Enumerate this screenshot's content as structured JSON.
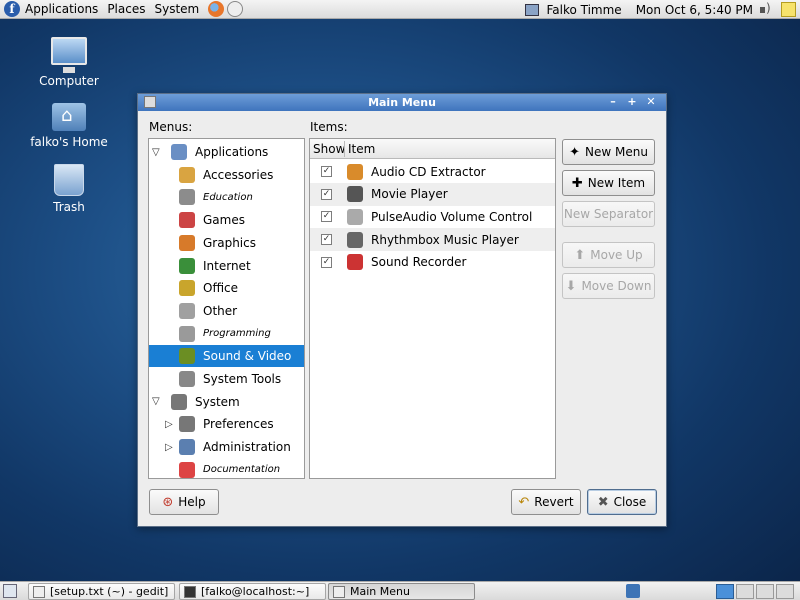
{
  "top_panel": {
    "applications": "Applications",
    "places": "Places",
    "system": "System",
    "user": "Falko Timme",
    "clock": "Mon Oct  6,  5:40 PM"
  },
  "desktop": {
    "icons": [
      {
        "label": "Computer",
        "icon": "computer-icon"
      },
      {
        "label": "falko's Home",
        "icon": "home-folder-icon"
      },
      {
        "label": "Trash",
        "icon": "trash-icon"
      }
    ]
  },
  "window": {
    "title": "Main Menu",
    "menus_label": "Menus:",
    "items_label": "Items:",
    "menus": [
      {
        "label": "Applications",
        "icon": "applications-icon",
        "level": 0,
        "expanded": true
      },
      {
        "label": "Accessories",
        "icon": "accessories-icon",
        "level": 1
      },
      {
        "label": "Education",
        "icon": "education-icon",
        "level": 1,
        "small": true
      },
      {
        "label": "Games",
        "icon": "games-icon",
        "level": 1
      },
      {
        "label": "Graphics",
        "icon": "graphics-icon",
        "level": 1
      },
      {
        "label": "Internet",
        "icon": "internet-icon",
        "level": 1
      },
      {
        "label": "Office",
        "icon": "office-icon",
        "level": 1
      },
      {
        "label": "Other",
        "icon": "other-icon",
        "level": 1
      },
      {
        "label": "Programming",
        "icon": "programming-icon",
        "level": 1,
        "small": true
      },
      {
        "label": "Sound & Video",
        "icon": "sound-video-icon",
        "level": 1,
        "selected": true
      },
      {
        "label": "System Tools",
        "icon": "system-tools-icon",
        "level": 1
      },
      {
        "label": "System",
        "icon": "system-icon",
        "level": 0,
        "expanded": true
      },
      {
        "label": "Preferences",
        "icon": "preferences-icon",
        "level": 1,
        "collapsed": true
      },
      {
        "label": "Administration",
        "icon": "administration-icon",
        "level": 1,
        "collapsed": true
      },
      {
        "label": "Documentation",
        "icon": "documentation-icon",
        "level": 1,
        "small": true
      }
    ],
    "items_header": {
      "show": "Show",
      "item": "Item"
    },
    "items": [
      {
        "label": "Audio CD Extractor",
        "icon": "cd-extractor-icon",
        "shown": true
      },
      {
        "label": "Movie Player",
        "icon": "movie-player-icon",
        "shown": true
      },
      {
        "label": "PulseAudio Volume Control",
        "icon": "volume-control-icon",
        "shown": true
      },
      {
        "label": "Rhythmbox Music Player",
        "icon": "rhythmbox-icon",
        "shown": true
      },
      {
        "label": "Sound Recorder",
        "icon": "sound-recorder-icon",
        "shown": true
      }
    ],
    "buttons": {
      "new_menu": "New Menu",
      "new_item": "New Item",
      "new_separator": "New Separator",
      "move_up": "Move Up",
      "move_down": "Move Down",
      "help": "Help",
      "revert": "Revert",
      "close": "Close"
    }
  },
  "taskbar": [
    {
      "label": "[setup.txt (~) - gedit]",
      "icon": "gedit-icon"
    },
    {
      "label": "[falko@localhost:~]",
      "icon": "terminal-icon"
    },
    {
      "label": "Main Menu",
      "icon": "main-menu-icon",
      "active": true
    }
  ],
  "colors": {
    "selection": "#1a7fd4",
    "titlebar": "#3f74bd",
    "desktop": "#1d4f86"
  }
}
